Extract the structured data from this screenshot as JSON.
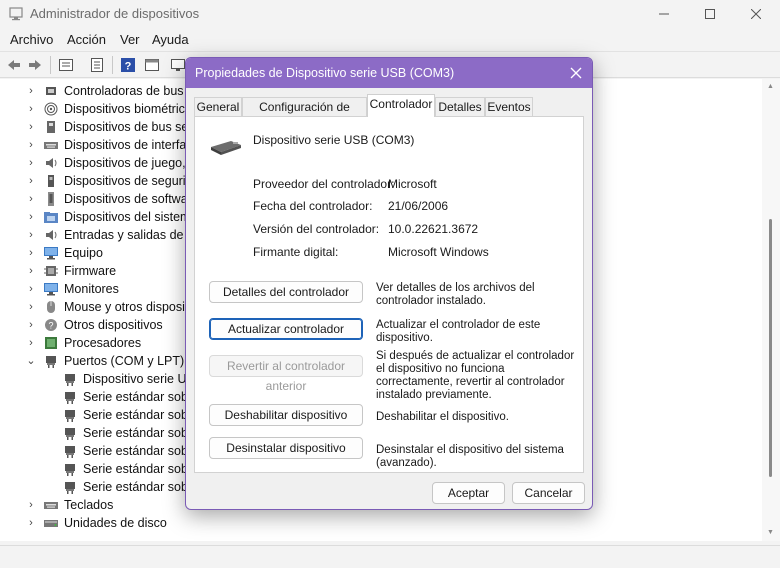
{
  "window": {
    "title": "Administrador de dispositivos"
  },
  "menu": [
    "Archivo",
    "Acción",
    "Ver",
    "Ayuda"
  ],
  "tree": {
    "items": [
      {
        "label": "Controladoras de bus s",
        "icon": "usb-controller-icon",
        "expanded": false
      },
      {
        "label": "Dispositivos biométrico",
        "icon": "fingerprint-icon",
        "expanded": false
      },
      {
        "label": "Dispositivos de bus seri",
        "icon": "device-icon",
        "expanded": false
      },
      {
        "label": "Dispositivos de interfaz",
        "icon": "keyboard-icon",
        "expanded": false
      },
      {
        "label": "Dispositivos de juego, s",
        "icon": "speaker-icon",
        "expanded": false
      },
      {
        "label": "Dispositivos de segurid",
        "icon": "security-key-icon",
        "expanded": false
      },
      {
        "label": "Dispositivos de softwar",
        "icon": "software-device-icon",
        "expanded": false
      },
      {
        "label": "Dispositivos del sistema",
        "icon": "system-folder-icon",
        "expanded": false
      },
      {
        "label": "Entradas y salidas de au",
        "icon": "speaker-icon",
        "expanded": false
      },
      {
        "label": "Equipo",
        "icon": "monitor-icon",
        "expanded": false
      },
      {
        "label": "Firmware",
        "icon": "firmware-icon",
        "expanded": false
      },
      {
        "label": "Monitores",
        "icon": "monitor-icon",
        "expanded": false
      },
      {
        "label": "Mouse y otros dispositi",
        "icon": "mouse-icon",
        "expanded": false
      },
      {
        "label": "Otros dispositivos",
        "icon": "unknown-device-icon",
        "expanded": false
      },
      {
        "label": "Procesadores",
        "icon": "processor-icon",
        "expanded": false
      },
      {
        "label": "Puertos (COM y LPT)",
        "icon": "port-icon",
        "expanded": true
      },
      {
        "label": "Dispositivo serie USB",
        "icon": "port-icon",
        "child": true
      },
      {
        "label": "Serie estándar sobre",
        "icon": "port-icon",
        "child": true
      },
      {
        "label": "Serie estándar sobre",
        "icon": "port-icon",
        "child": true
      },
      {
        "label": "Serie estándar sobre",
        "icon": "port-icon",
        "child": true
      },
      {
        "label": "Serie estándar sobre",
        "icon": "port-icon",
        "child": true
      },
      {
        "label": "Serie estándar sobre",
        "icon": "port-icon",
        "child": true
      },
      {
        "label": "Serie estándar sobre",
        "icon": "port-icon",
        "child": true
      },
      {
        "label": "Teclados",
        "icon": "keyboard-icon",
        "expanded": false
      },
      {
        "label": "Unidades de disco",
        "icon": "disk-icon",
        "expanded": false
      }
    ]
  },
  "dialog": {
    "title": "Propiedades de Dispositivo serie USB (COM3)",
    "tabs": [
      "General",
      "Configuración de puerto",
      "Controlador",
      "Detalles",
      "Eventos"
    ],
    "active_tab": "Controlador",
    "device_name": "Dispositivo serie USB (COM3)",
    "properties": [
      {
        "label": "Proveedor del controlador:",
        "value": "Microsoft"
      },
      {
        "label": "Fecha del controlador:",
        "value": "21/06/2006"
      },
      {
        "label": "Versión del controlador:",
        "value": "10.0.22621.3672"
      },
      {
        "label": "Firmante digital:",
        "value": "Microsoft Windows"
      }
    ],
    "actions": [
      {
        "button": "Detalles del controlador",
        "desc_lines": [
          "Ver detalles de los archivos del",
          "controlador instalado."
        ],
        "enabled": true,
        "focused": false
      },
      {
        "button": "Actualizar controlador",
        "desc_lines": [
          "Actualizar el controlador de este",
          "dispositivo."
        ],
        "enabled": true,
        "focused": true
      },
      {
        "button": "Revertir al controlador anterior",
        "desc_lines": [
          "Si después de actualizar el controlador",
          "el dispositivo no funciona",
          "correctamente, revertir al controlador",
          "instalado previamente."
        ],
        "enabled": false,
        "focused": false
      },
      {
        "button": "Deshabilitar dispositivo",
        "desc_lines": [
          "Deshabilitar el dispositivo."
        ],
        "enabled": true,
        "focused": false
      },
      {
        "button": "Desinstalar dispositivo",
        "desc_lines": [
          "Desinstalar el dispositivo del sistema",
          "(avanzado)."
        ],
        "enabled": true,
        "focused": false
      }
    ],
    "ok_label": "Aceptar",
    "cancel_label": "Cancelar"
  },
  "colors": {
    "dialog_titlebar": "#8c6bc6",
    "focus_border": "#1e63b8"
  }
}
